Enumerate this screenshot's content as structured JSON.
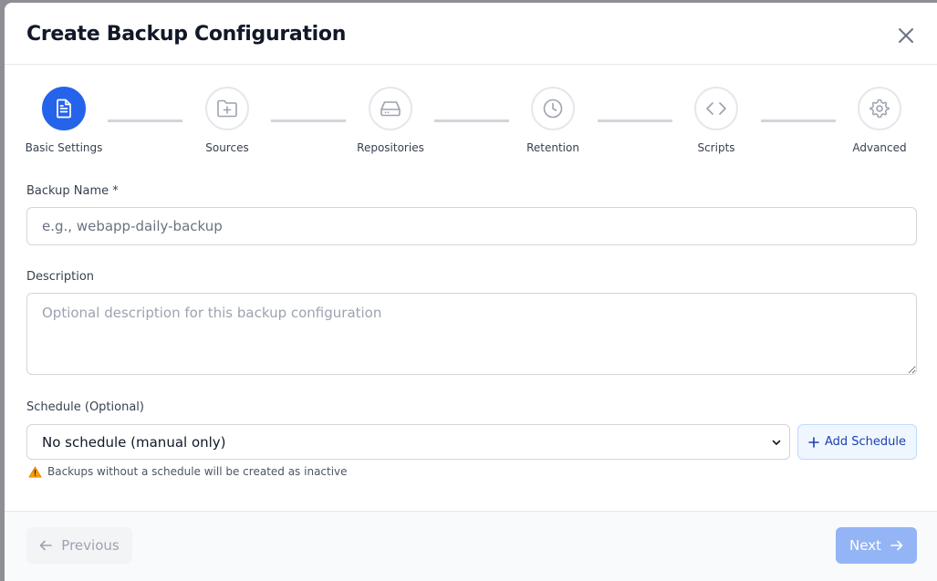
{
  "dialog": {
    "title": "Create Backup Configuration"
  },
  "steps": [
    {
      "label": "Basic Settings",
      "icon": "document-icon",
      "active": true
    },
    {
      "label": "Sources",
      "icon": "folder-plus-icon",
      "active": false
    },
    {
      "label": "Repositories",
      "icon": "hard-drive-icon",
      "active": false
    },
    {
      "label": "Retention",
      "icon": "clock-icon",
      "active": false
    },
    {
      "label": "Scripts",
      "icon": "code-icon",
      "active": false
    },
    {
      "label": "Advanced",
      "icon": "gear-icon",
      "active": false
    }
  ],
  "form": {
    "name_label": "Backup Name *",
    "name_placeholder": "e.g., webapp-daily-backup",
    "name_value": "",
    "description_label": "Description",
    "description_placeholder": "Optional description for this backup configuration",
    "description_value": "",
    "schedule_label": "Schedule (Optional)",
    "schedule_selected": "No schedule (manual only)",
    "add_schedule_label": "Add Schedule",
    "schedule_warning": "Backups without a schedule will be created as inactive"
  },
  "footer": {
    "previous_label": "Previous",
    "next_label": "Next"
  },
  "colors": {
    "accent": "#2563eb",
    "next_disabled": "#93b4f5",
    "warning": "#f59e0b"
  }
}
